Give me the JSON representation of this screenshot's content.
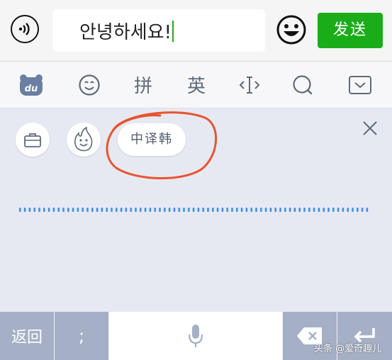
{
  "chat": {
    "input_value": "안녕하세요!",
    "send_label": "发送"
  },
  "toolbar": {
    "pinyin_label": "拼",
    "english_label": "英"
  },
  "panel": {
    "translate_chip_label": "中译韩"
  },
  "keys": {
    "back_label": "返回",
    "semicolon_label": ";"
  },
  "watermark": "头条 @爱奇趣儿",
  "colors": {
    "send_green": "#1aad19",
    "panel_bg": "#e6e9f2",
    "key_dark": "#a5b0c6",
    "dots_blue": "#3d8ee6",
    "annotation_red": "#e8542f"
  },
  "icons": {
    "voice": "voice-icon",
    "emoji": "emoji-icon",
    "keyboard_logo": "du-logo-icon",
    "smiley": "smiley-icon",
    "cursor": "cursor-icon",
    "search": "search-icon",
    "collapse": "collapse-keyboard-icon",
    "briefcase": "briefcase-icon",
    "fire_face": "fire-face-icon",
    "close": "close-icon",
    "mic": "microphone-icon",
    "delete": "delete-icon",
    "enter": "enter-icon"
  }
}
